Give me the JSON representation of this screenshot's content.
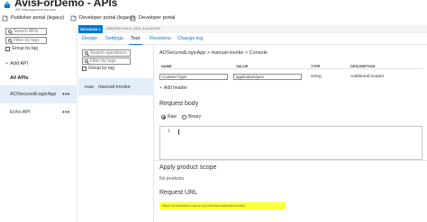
{
  "header": {
    "app_title": "AvisForDemo - APIs",
    "app_subtitle": "API Management service",
    "commands": [
      {
        "label": "Publisher portal (legacy)",
        "icon": "portal-icon"
      },
      {
        "label": "Developer portal (legacy)",
        "icon": "portal-icon"
      },
      {
        "label": "Developer portal",
        "icon": "portal-icon"
      }
    ]
  },
  "left": {
    "search_placeholder": "Search APIs",
    "filter_placeholder": "Filter by tags",
    "group_by_tag": "Group by tag",
    "add_api": "Add API",
    "all_apis": "All APIs",
    "apis": [
      {
        "name": "AOSecuredLogicApp",
        "selected": true
      },
      {
        "name": "Echo API",
        "selected": false
      }
    ]
  },
  "revision": {
    "badge": "REVISION 1",
    "created": "CREATED Feb 8, 2020, 5:49:53 PM"
  },
  "tabs": [
    "Design",
    "Settings",
    "Test",
    "Revisions",
    "Change log"
  ],
  "active_tab": "Test",
  "operations": {
    "search_placeholder": "Search operations",
    "filter_placeholder": "Filter by tags",
    "group_by_tag": "Group by tag",
    "items": [
      {
        "method": "POST",
        "name": "manual-invoke"
      }
    ]
  },
  "console": {
    "breadcrumb": "AOSecuredLogicApp > manual-invoke > Console",
    "columns": {
      "name": "NAME",
      "value": "VALUE",
      "type": "TYPE",
      "description": "DESCRIPTION"
    },
    "header_row": {
      "name": "Content-Type",
      "value": "application/json",
      "type": "string",
      "description": "Additional header"
    },
    "add_header": "Add header",
    "request_body_title": "Request body",
    "body_options": [
      "Raw",
      "Binary"
    ],
    "selected_body": "Raw",
    "editor_line": "1",
    "product_scope_title": "Apply product scope",
    "no_products": "No products",
    "request_url_title": "Request URL",
    "request_url": "https://aosforrdemo.azure-api.net/manual/paths/invoke"
  },
  "colors": {
    "accent": "#0078d4",
    "selected_bg": "#e4eef8",
    "highlight": "#ffff3a"
  }
}
